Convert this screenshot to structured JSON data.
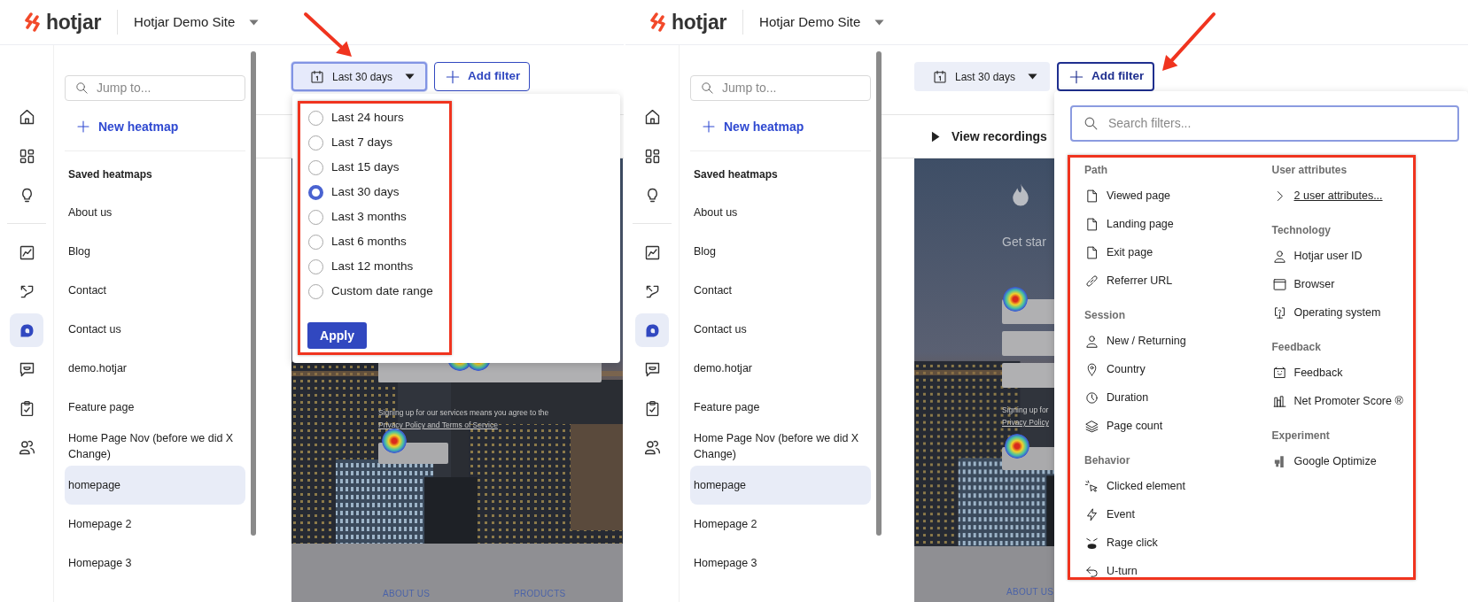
{
  "screens": [
    {
      "logo": "hotjar",
      "site_name": "Hotjar Demo Site",
      "nav_rail": [
        {
          "selected": false
        },
        {
          "selected": false
        },
        {
          "selected": false
        },
        {
          "selected": false
        },
        {
          "selected": false
        },
        {
          "selected": true
        },
        {
          "selected": false
        },
        {
          "selected": false
        },
        {
          "selected": false
        }
      ],
      "sidebar": {
        "search_placeholder": "Jump to...",
        "new_button": "New heatmap",
        "section_title": "Saved heatmaps",
        "items": [
          {
            "label": "About us",
            "selected": false
          },
          {
            "label": "Blog",
            "selected": false
          },
          {
            "label": "Contact",
            "selected": false
          },
          {
            "label": "Contact us",
            "selected": false
          },
          {
            "label": "demo.hotjar",
            "selected": false
          },
          {
            "label": "Feature page",
            "selected": false
          },
          {
            "label": "Home Page Nov (before we did X Change)",
            "selected": false
          },
          {
            "label": "homepage",
            "selected": true
          },
          {
            "label": "Homepage 2",
            "selected": false
          },
          {
            "label": "Homepage 3",
            "selected": false
          }
        ]
      },
      "date_button": {
        "label": "Last 30 days",
        "open": true
      },
      "filter_button": {
        "label": "Add filter",
        "open": false
      },
      "date_menu": {
        "options": [
          {
            "label": "Last 24 hours",
            "selected": false
          },
          {
            "label": "Last 7 days",
            "selected": false
          },
          {
            "label": "Last 15 days",
            "selected": false
          },
          {
            "label": "Last 30 days",
            "selected": true
          },
          {
            "label": "Last 3 months",
            "selected": false
          },
          {
            "label": "Last 6 months",
            "selected": false
          },
          {
            "label": "Last 12 months",
            "selected": false
          },
          {
            "label": "Custom date range",
            "selected": false
          }
        ],
        "apply_button": "Apply"
      },
      "preview": {
        "texts": [
          {
            "kind": "legal",
            "text": "Signing up for our services means you agree to the"
          },
          {
            "kind": "legal",
            "text": "Privacy Policy and Terms of Service"
          },
          {
            "kind": "footer_link",
            "text": "ABOUT US"
          },
          {
            "kind": "footer_link",
            "text": "PRODUCTS"
          }
        ]
      }
    },
    {
      "logo": "hotjar",
      "site_name": "Hotjar Demo Site",
      "nav_rail": [
        {
          "selected": false
        },
        {
          "selected": false
        },
        {
          "selected": false
        },
        {
          "selected": false
        },
        {
          "selected": false
        },
        {
          "selected": true
        },
        {
          "selected": false
        },
        {
          "selected": false
        },
        {
          "selected": false
        }
      ],
      "sidebar": {
        "search_placeholder": "Jump to...",
        "new_button": "New heatmap",
        "section_title": "Saved heatmaps",
        "items": [
          {
            "label": "About us",
            "selected": false
          },
          {
            "label": "Blog",
            "selected": false
          },
          {
            "label": "Contact",
            "selected": false
          },
          {
            "label": "Contact us",
            "selected": false
          },
          {
            "label": "demo.hotjar",
            "selected": false
          },
          {
            "label": "Feature page",
            "selected": false
          },
          {
            "label": "Home Page Nov (before we did X Change)",
            "selected": false
          },
          {
            "label": "homepage",
            "selected": true
          },
          {
            "label": "Homepage 2",
            "selected": false
          },
          {
            "label": "Homepage 3",
            "selected": false
          }
        ]
      },
      "date_button": {
        "label": "Last 30 days",
        "open": false
      },
      "filter_button": {
        "label": "Add filter",
        "open": true
      },
      "view_recordings_button": "View recordings",
      "filter_menu": {
        "search_placeholder": "Search filters...",
        "columns": [
          [
            {
              "title": "Path",
              "items": [
                {
                  "kind": "item",
                  "label": "Viewed page"
                },
                {
                  "kind": "item",
                  "label": "Landing page"
                },
                {
                  "kind": "item",
                  "label": "Exit page"
                },
                {
                  "kind": "item",
                  "label": "Referrer URL"
                }
              ]
            },
            {
              "title": "Session",
              "items": [
                {
                  "kind": "item",
                  "label": "New / Returning"
                },
                {
                  "kind": "item",
                  "label": "Country"
                },
                {
                  "kind": "item",
                  "label": "Duration"
                },
                {
                  "kind": "item",
                  "label": "Page count"
                }
              ]
            },
            {
              "title": "Behavior",
              "items": [
                {
                  "kind": "item",
                  "label": "Clicked element"
                },
                {
                  "kind": "item",
                  "label": "Event"
                },
                {
                  "kind": "item",
                  "label": "Rage click"
                },
                {
                  "kind": "item",
                  "label": "U-turn"
                }
              ]
            }
          ],
          [
            {
              "title": "User attributes",
              "items": [
                {
                  "kind": "link",
                  "label": "2 user attributes..."
                }
              ]
            },
            {
              "title": "Technology",
              "items": [
                {
                  "kind": "item",
                  "label": "Hotjar user ID"
                },
                {
                  "kind": "item",
                  "label": "Browser"
                },
                {
                  "kind": "item",
                  "label": "Operating system"
                }
              ]
            },
            {
              "title": "Feedback",
              "items": [
                {
                  "kind": "item",
                  "label": "Feedback"
                },
                {
                  "kind": "item",
                  "label": "Net Promoter Score ®"
                }
              ]
            },
            {
              "title": "Experiment",
              "items": [
                {
                  "kind": "item",
                  "label": "Google Optimize"
                }
              ]
            }
          ]
        ]
      },
      "preview": {
        "texts": [
          {
            "kind": "headline",
            "text": "Get star"
          },
          {
            "kind": "legal",
            "text": "Signing up for"
          },
          {
            "kind": "legal",
            "text": "Privacy Policy"
          },
          {
            "kind": "footer_link",
            "text": "ABOUT US"
          }
        ]
      }
    }
  ]
}
